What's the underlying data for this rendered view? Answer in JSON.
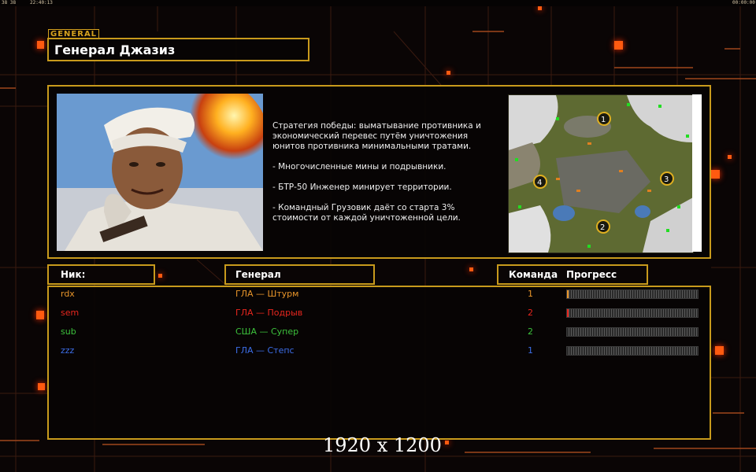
{
  "topbar": {
    "left_status": "38 38",
    "left_time": "22:40:13",
    "right_time": "00:00:00"
  },
  "header": {
    "general_tag": "GENERAL",
    "title": "Генерал Джазиз"
  },
  "description": {
    "lines": [
      "Стратегия победы: выматывание противника и экономический перевес путём уничтожения юнитов противника минимальными тратами.",
      "- Многочисленные мины и подрывники.",
      "- БТР-50 Инженер минирует территории.",
      "- Командный Грузовик даёт со старта 3% стоимости от каждой уничтоженной цели."
    ]
  },
  "map": {
    "markers": [
      "1",
      "2",
      "3",
      "4"
    ]
  },
  "table": {
    "headers": {
      "nick": "Ник:",
      "general": "Генерал",
      "team": "Команда",
      "progress": "Прогресс"
    },
    "rows": [
      {
        "nick": "rdx",
        "general": "ГЛА — Штурм",
        "team": "1",
        "color": "#e8952a",
        "progress": 0.01
      },
      {
        "nick": "sem",
        "general": "ГЛА — Подрыв",
        "team": "2",
        "color": "#e8261e",
        "progress": 0.01
      },
      {
        "nick": "sub",
        "general": "США — Супер",
        "team": "2",
        "color": "#3cc23c",
        "progress": 0.0
      },
      {
        "nick": "zzz",
        "general": "ГЛА — Степс",
        "team": "1",
        "color": "#3c6ee8",
        "progress": 0.0
      }
    ]
  },
  "footer": {
    "resolution": "1920 x 1200"
  },
  "colors": {
    "accent": "#c89a1c",
    "glow": "#ff5a10"
  }
}
